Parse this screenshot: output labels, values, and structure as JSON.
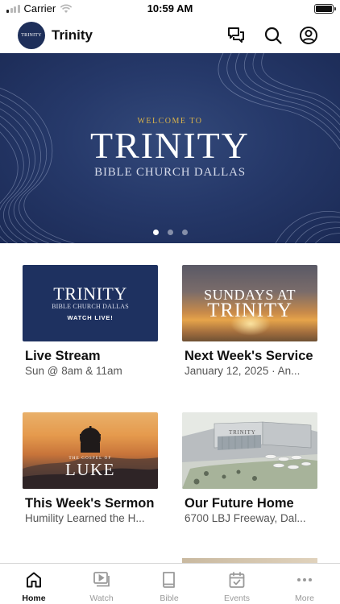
{
  "status_bar": {
    "carrier": "Carrier",
    "time": "10:59 AM"
  },
  "header": {
    "logo_text": "TRINITY",
    "title": "Trinity",
    "icons": [
      "chat-icon",
      "search-icon",
      "profile-icon"
    ]
  },
  "hero": {
    "welcome": "WELCOME TO",
    "title": "TRINITY",
    "subtitle": "BIBLE CHURCH DALLAS",
    "page_count": 3,
    "active_page": 1
  },
  "cards": [
    {
      "title": "Live Stream",
      "subtitle": "Sun @ 8am & 11am",
      "thumb_title": "TRINITY",
      "thumb_subtitle": "BIBLE CHURCH DALLAS",
      "thumb_cta": "WATCH LIVE!"
    },
    {
      "title": "Next Week's Service",
      "subtitle": "January 12, 2025 · An...",
      "thumb_line1": "SUNDAYS AT",
      "thumb_line2": "TRINITY"
    },
    {
      "title": "This Week's Sermon",
      "subtitle": "Humility Learned the H...",
      "thumb_small": "THE GOSPEL OF",
      "thumb_big": "LUKE"
    },
    {
      "title": "Our Future Home",
      "subtitle": "6700 LBJ Freeway, Dal...",
      "thumb_word": "TRINITY"
    }
  ],
  "tabbar": {
    "tabs": [
      {
        "label": "Home",
        "icon": "home-icon",
        "active": true
      },
      {
        "label": "Watch",
        "icon": "video-icon",
        "active": false
      },
      {
        "label": "Bible",
        "icon": "book-icon",
        "active": false
      },
      {
        "label": "Events",
        "icon": "calendar-icon",
        "active": false
      },
      {
        "label": "More",
        "icon": "more-icon",
        "active": false
      }
    ]
  },
  "colors": {
    "brand_navy": "#1e2f5a",
    "hero_gold": "#d9b24a",
    "tab_active": "#111111",
    "tab_inactive": "#9a9a9a"
  }
}
